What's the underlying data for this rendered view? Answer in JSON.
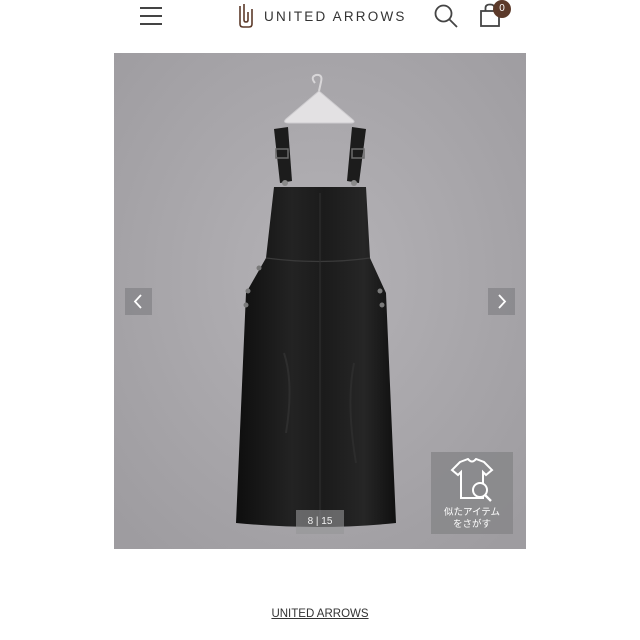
{
  "header": {
    "brand": "UNITED ARROWS",
    "cart_count": "0",
    "icons": [
      "hamburger-menu-icon",
      "brand-logo-icon",
      "search-icon",
      "shopping-bag-icon"
    ]
  },
  "gallery": {
    "counter": "8 | 15",
    "prev_icon": "chevron-left-icon",
    "next_icon": "chevron-right-icon",
    "similar_label": "似たアイテム\nをさがす",
    "colors": {
      "background": "#a9a7ab",
      "product": "#1a1a1a"
    }
  },
  "footer": {
    "brand_link": "UNITED ARROWS"
  },
  "colors": {
    "badge": "#5c3a2a",
    "text": "#333333"
  }
}
